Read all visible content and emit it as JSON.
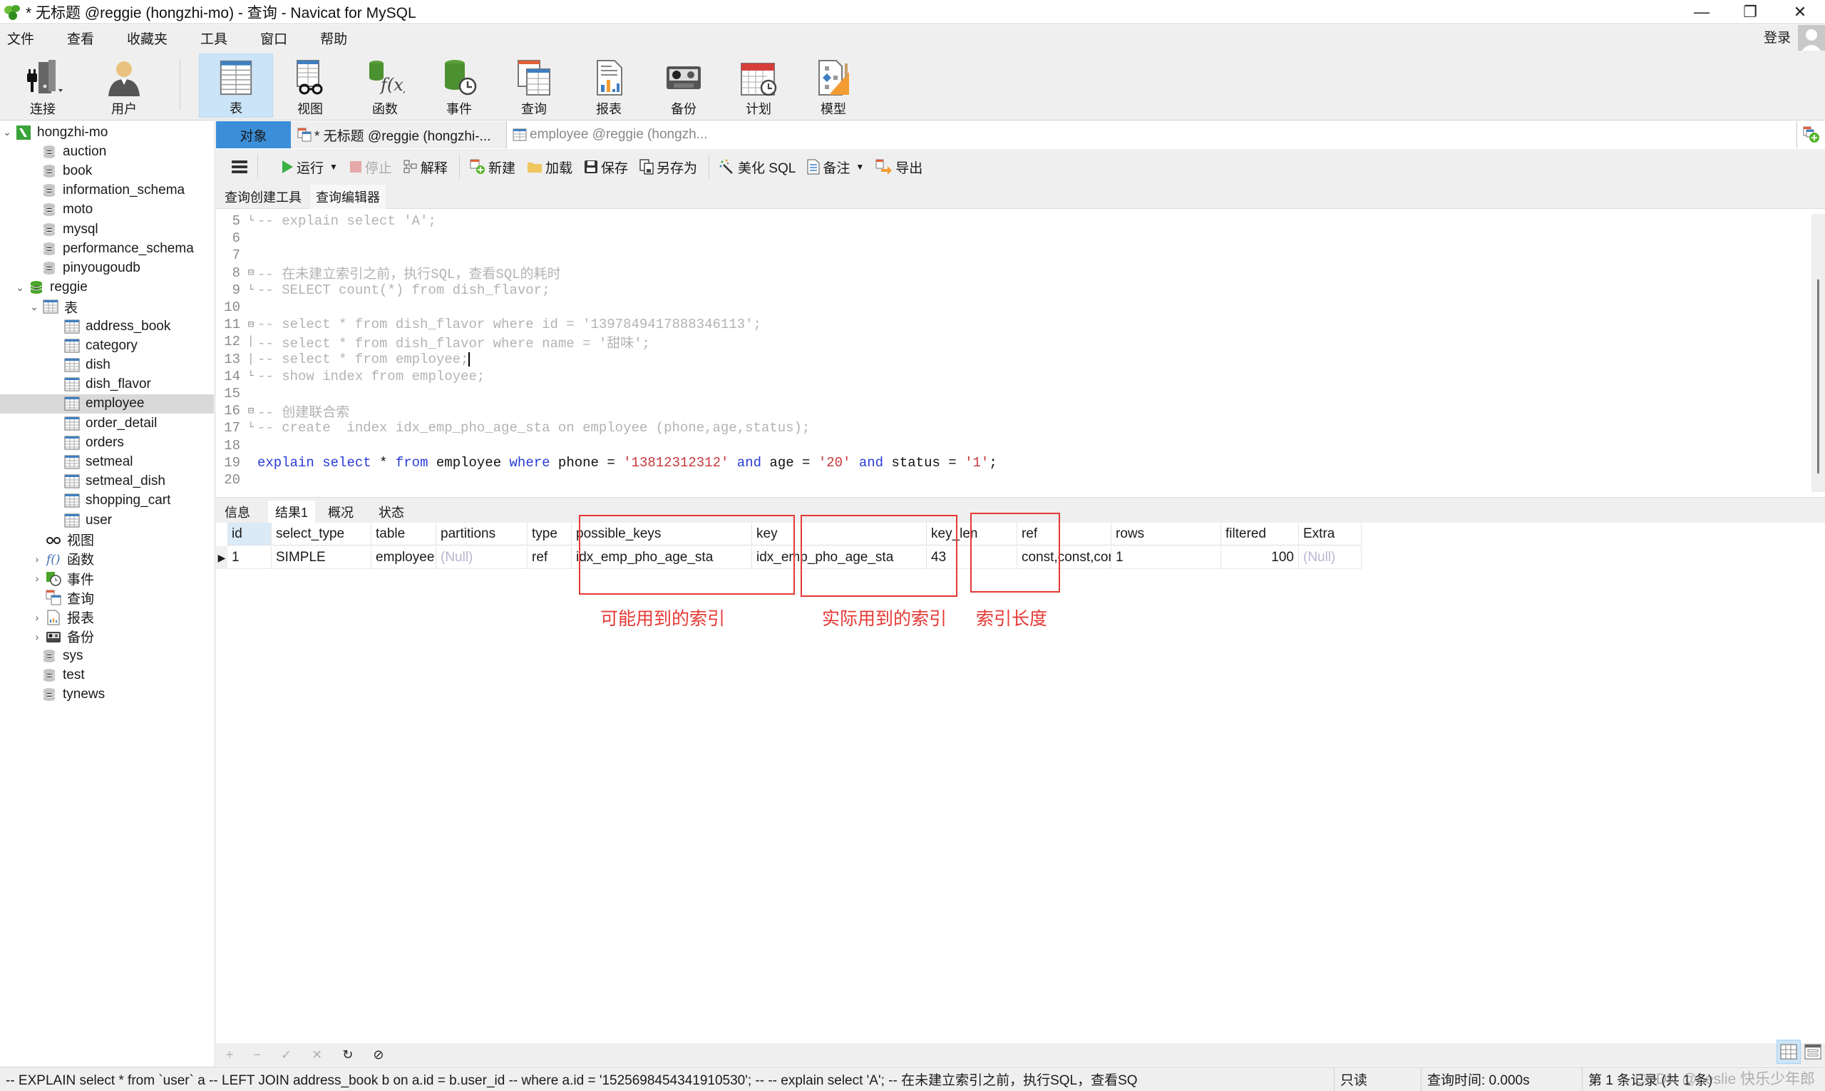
{
  "window": {
    "title": "* 无标题 @reggie (hongzhi-mo) - 查询 - Navicat for MySQL",
    "minimize": "—",
    "restore": "❐",
    "close": "✕"
  },
  "menu": {
    "items": [
      "文件",
      "查看",
      "收藏夹",
      "工具",
      "窗口",
      "帮助"
    ],
    "login": "登录"
  },
  "toolbar": {
    "items": [
      {
        "label": "连接",
        "icon": "connection-icon"
      },
      {
        "label": "用户",
        "icon": "user-icon"
      },
      {
        "label": "表",
        "icon": "table-icon",
        "active": true
      },
      {
        "label": "视图",
        "icon": "view-icon"
      },
      {
        "label": "函数",
        "icon": "function-icon"
      },
      {
        "label": "事件",
        "icon": "event-icon"
      },
      {
        "label": "查询",
        "icon": "query-icon"
      },
      {
        "label": "报表",
        "icon": "report-icon"
      },
      {
        "label": "备份",
        "icon": "backup-icon"
      },
      {
        "label": "计划",
        "icon": "schedule-icon"
      },
      {
        "label": "模型",
        "icon": "model-icon"
      }
    ]
  },
  "tree": {
    "connection": "hongzhi-mo",
    "databases_before": [
      "auction",
      "book",
      "information_schema",
      "moto",
      "mysql",
      "performance_schema",
      "pinyougoudb"
    ],
    "open_database": "reggie",
    "tables_group": "表",
    "tables": [
      "address_book",
      "category",
      "dish",
      "dish_flavor",
      "employee",
      "order_detail",
      "orders",
      "setmeal",
      "setmeal_dish",
      "shopping_cart",
      "user"
    ],
    "selected_table": "employee",
    "groups": [
      "视图",
      "函数",
      "事件",
      "查询",
      "报表",
      "备份"
    ],
    "databases_after": [
      "sys",
      "test",
      "tynews"
    ]
  },
  "tabs": {
    "objects": "对象",
    "query": "* 无标题 @reggie (hongzhi-...",
    "employee": "employee @reggie (hongzh..."
  },
  "query_toolbar": {
    "run": "运行",
    "stop": "停止",
    "explain": "解释",
    "new": "新建",
    "load": "加载",
    "save": "保存",
    "save_as": "另存为",
    "beautify": "美化 SQL",
    "comment": "备注",
    "export": "导出"
  },
  "sub_tabs": [
    "查询创建工具",
    "查询编辑器"
  ],
  "editor": {
    "lines": [
      {
        "n": "5",
        "fold": "end",
        "text": "-- explain select 'A';",
        "type": "comment"
      },
      {
        "n": "6",
        "fold": "",
        "text": "",
        "type": "blank"
      },
      {
        "n": "7",
        "fold": "",
        "text": "",
        "type": "blank"
      },
      {
        "n": "8",
        "fold": "start",
        "text": "-- 在未建立索引之前，执行SQL，查看SQL的耗时",
        "type": "comment"
      },
      {
        "n": "9",
        "fold": "end",
        "text": "-- SELECT count(*) from dish_flavor;",
        "type": "comment"
      },
      {
        "n": "10",
        "fold": "",
        "text": "",
        "type": "blank"
      },
      {
        "n": "11",
        "fold": "start",
        "text": "-- select * from dish_flavor where id = '1397849417888346113';",
        "type": "comment"
      },
      {
        "n": "12",
        "fold": "mid",
        "text": "-- select * from dish_flavor where name = '甜味';",
        "type": "comment"
      },
      {
        "n": "13",
        "fold": "mid",
        "text": "-- select * from employee;",
        "type": "comment"
      },
      {
        "n": "14",
        "fold": "end",
        "text": "-- show index from employee;",
        "type": "comment"
      },
      {
        "n": "15",
        "fold": "",
        "text": "",
        "type": "blank"
      },
      {
        "n": "16",
        "fold": "start",
        "text": "-- 创建联合索",
        "type": "comment"
      },
      {
        "n": "17",
        "fold": "end",
        "text": "-- create  index idx_emp_pho_age_sta on employee (phone,age,status);",
        "type": "comment"
      },
      {
        "n": "18",
        "fold": "",
        "text": "",
        "type": "blank"
      },
      {
        "n": "19",
        "fold": "",
        "type": "code",
        "tokens": [
          {
            "t": "explain",
            "c": "kw"
          },
          {
            "t": " ",
            "c": "ident"
          },
          {
            "t": "select",
            "c": "kw"
          },
          {
            "t": " * ",
            "c": "ident"
          },
          {
            "t": "from",
            "c": "kw"
          },
          {
            "t": " employee ",
            "c": "ident"
          },
          {
            "t": "where",
            "c": "kw"
          },
          {
            "t": " phone = ",
            "c": "ident"
          },
          {
            "t": "'13812312312'",
            "c": "str"
          },
          {
            "t": " ",
            "c": "ident"
          },
          {
            "t": "and",
            "c": "kw"
          },
          {
            "t": " age = ",
            "c": "ident"
          },
          {
            "t": "'20'",
            "c": "str"
          },
          {
            "t": " ",
            "c": "ident"
          },
          {
            "t": "and",
            "c": "kw"
          },
          {
            "t": " status = ",
            "c": "ident"
          },
          {
            "t": "'1'",
            "c": "str"
          },
          {
            "t": ";",
            "c": "ident"
          }
        ]
      },
      {
        "n": "20",
        "fold": "",
        "text": "",
        "type": "blank"
      }
    ]
  },
  "result_tabs": [
    "信息",
    "结果1",
    "概况",
    "状态"
  ],
  "result_active_tab": "结果1",
  "results": {
    "columns": [
      "id",
      "select_type",
      "table",
      "partitions",
      "type",
      "possible_keys",
      "key",
      "key_len",
      "ref",
      "rows",
      "filtered",
      "Extra"
    ],
    "rows": [
      [
        "1",
        "SIMPLE",
        "employee",
        "(Null)",
        "ref",
        "idx_emp_pho_age_sta",
        "idx_emp_pho_age_sta",
        "43",
        "const,const,const",
        "1",
        "100",
        "(Null)"
      ]
    ]
  },
  "annotations": {
    "possible_keys": "可能用到的索引",
    "key": "实际用到的索引",
    "key_len": "索引长度",
    "color": "#e53935"
  },
  "grid_bar": {
    "add": "+",
    "remove": "−",
    "apply": "✓",
    "discard": "✕",
    "refresh": "↻",
    "stop": "⊘"
  },
  "status": {
    "sql": "-- EXPLAIN select * from `user` a -- LEFT JOIN address_book b on a.id = b.user_id -- where a.id = '1525698454341910530'; --  -- explain select 'A';   -- 在未建立索引之前，执行SQL，查看SQ",
    "readonly": "只读",
    "query_time": "查询时间: 0.000s",
    "record": "第 1 条记录 (共 1 条)",
    "watermark": "CSDN @Leslie 快乐少年郎"
  },
  "colors": {
    "accent": "#3b8fd9",
    "selection": "#cce4f7",
    "keyword": "#2a3bd6",
    "string": "#c8373b",
    "comment": "#b3b3b3"
  }
}
